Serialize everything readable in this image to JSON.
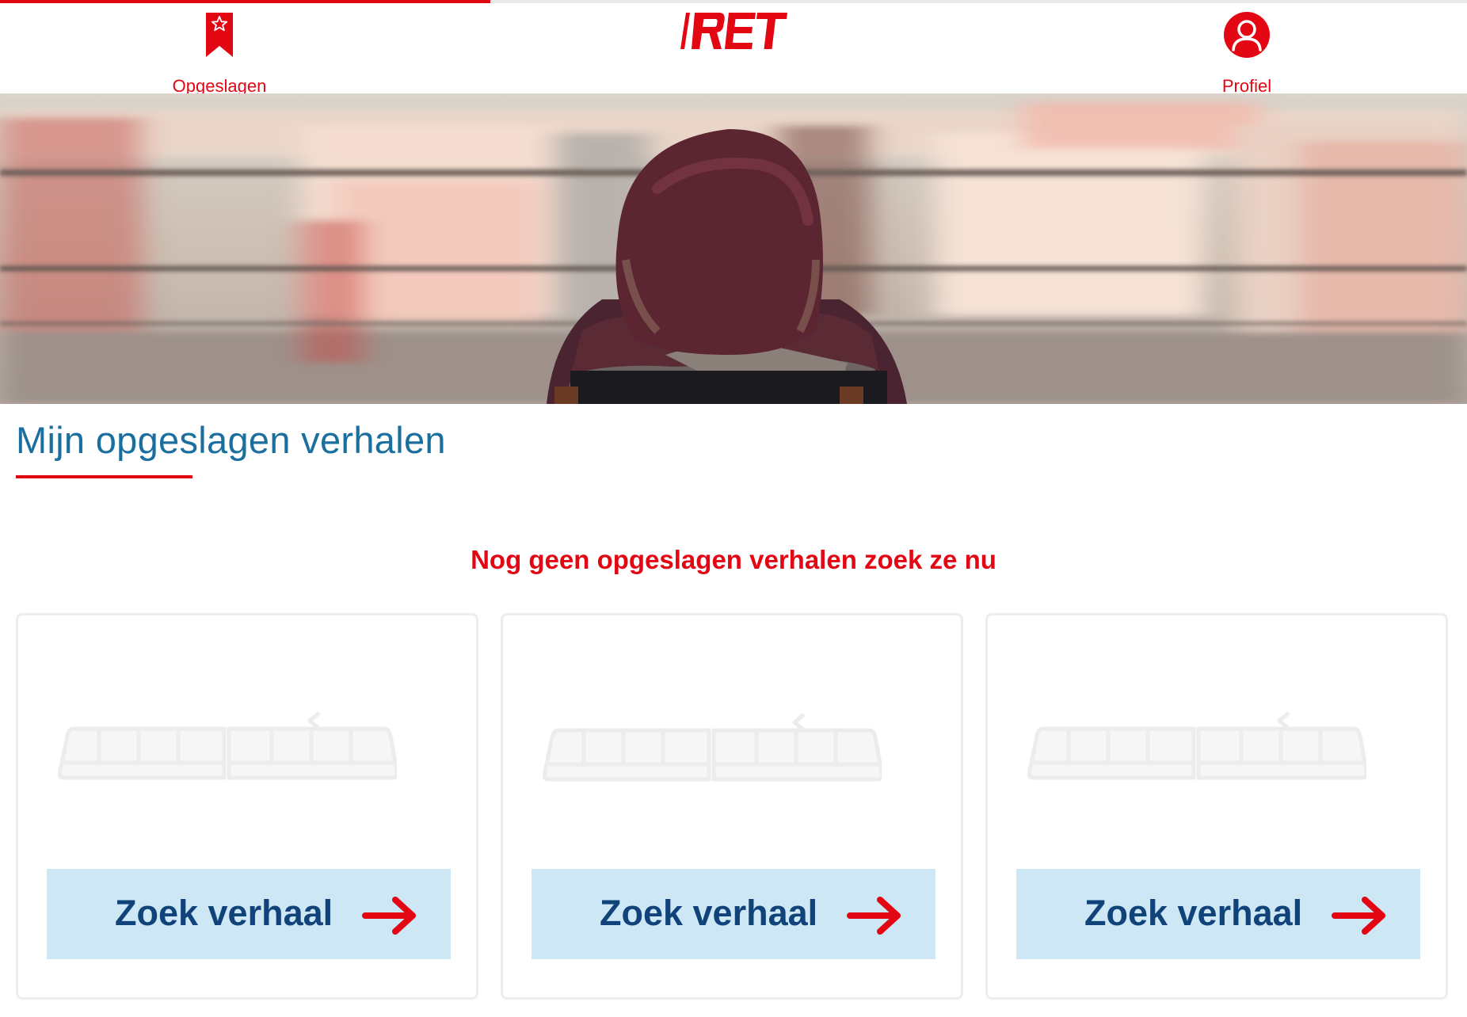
{
  "header": {
    "brand": "RET",
    "nav": {
      "saved_label": "Opgeslagen",
      "profile_label": "Profiel"
    },
    "progress_fraction": 0.334
  },
  "colors": {
    "brand_red": "#e30613",
    "title_blue": "#1a6f9f",
    "button_bg": "#cde7f5",
    "button_text": "#10437a"
  },
  "page": {
    "title": "Mijn opgeslagen verhalen",
    "empty_message": "Nog geen opgeslagen verhalen zoek ze nu"
  },
  "cards": [
    {
      "button_label": "Zoek verhaal",
      "illustration": "tram-icon",
      "button_icon": "arrow-right-icon"
    },
    {
      "button_label": "Zoek verhaal",
      "illustration": "tram-icon",
      "button_icon": "arrow-right-icon"
    },
    {
      "button_label": "Zoek verhaal",
      "illustration": "tram-icon",
      "button_icon": "arrow-right-icon"
    }
  ],
  "icons": {
    "saved": "bookmark-star-icon",
    "profile": "user-circle-icon"
  }
}
